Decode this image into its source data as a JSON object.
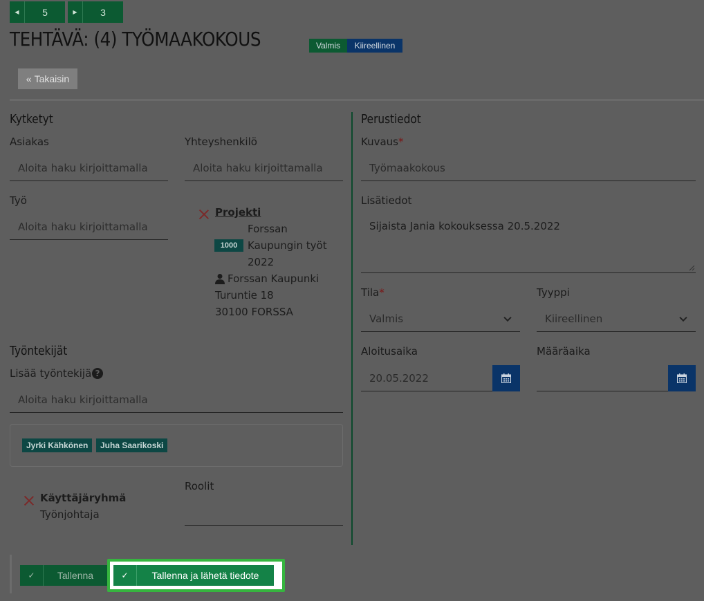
{
  "nav": {
    "prev_count": "5",
    "next_count": "3"
  },
  "header": {
    "title": "TEHTÄVÄ: (4) TYÖMAAKOKOUS",
    "status_badge": "Valmis",
    "type_badge": "Kiireellinen",
    "back_label": "Takaisin"
  },
  "links": {
    "heading": "Kytketyt",
    "customer_label": "Asiakas",
    "customer_placeholder": "Aloita haku kirjoittamalla",
    "contact_label": "Yhteyshenkilö",
    "contact_placeholder": "Aloita haku kirjoittamalla",
    "work_label": "Työ",
    "work_placeholder": "Aloita haku kirjoittamalla",
    "project": {
      "heading": "Projekti",
      "code": "1000",
      "name_line1": "Forssan",
      "name_line2": "Kaupungin työt",
      "name_line3": "2022",
      "customer": "Forssan Kaupunki",
      "street": "Turuntie 18",
      "postal": "30100 FORSSA"
    }
  },
  "workers": {
    "heading": "Työntekijät",
    "add_label": "Lisää työntekijä",
    "add_placeholder": "Aloita haku kirjoittamalla",
    "tags": [
      "Jyrki Kähkönen",
      "Juha Saarikoski"
    ],
    "group_heading": "Käyttäjäryhmä",
    "group_value": "Työnjohtaja",
    "roles_label": "Roolit"
  },
  "basic": {
    "heading": "Perustiedot",
    "description_label": "Kuvaus",
    "description_value": "Työmaakokous",
    "extra_label": "Lisätiedot",
    "extra_value": "Sijaista Jania kokouksessa 20.5.2022",
    "status_label": "Tila",
    "status_value": "Valmis",
    "type_label": "Tyyppi",
    "type_value": "Kiireellinen",
    "start_label": "Aloitusaika",
    "start_value": "20.05.2022",
    "deadline_label": "Määräaika",
    "deadline_value": ""
  },
  "footer": {
    "save_label": "Tallenna",
    "save_send_label": "Tallenna ja lähetä tiedote"
  },
  "colors": {
    "backdrop": "#5e5e5e",
    "green": "#0c5a32",
    "blue": "#0a3468",
    "highlight": "#36b53f"
  }
}
